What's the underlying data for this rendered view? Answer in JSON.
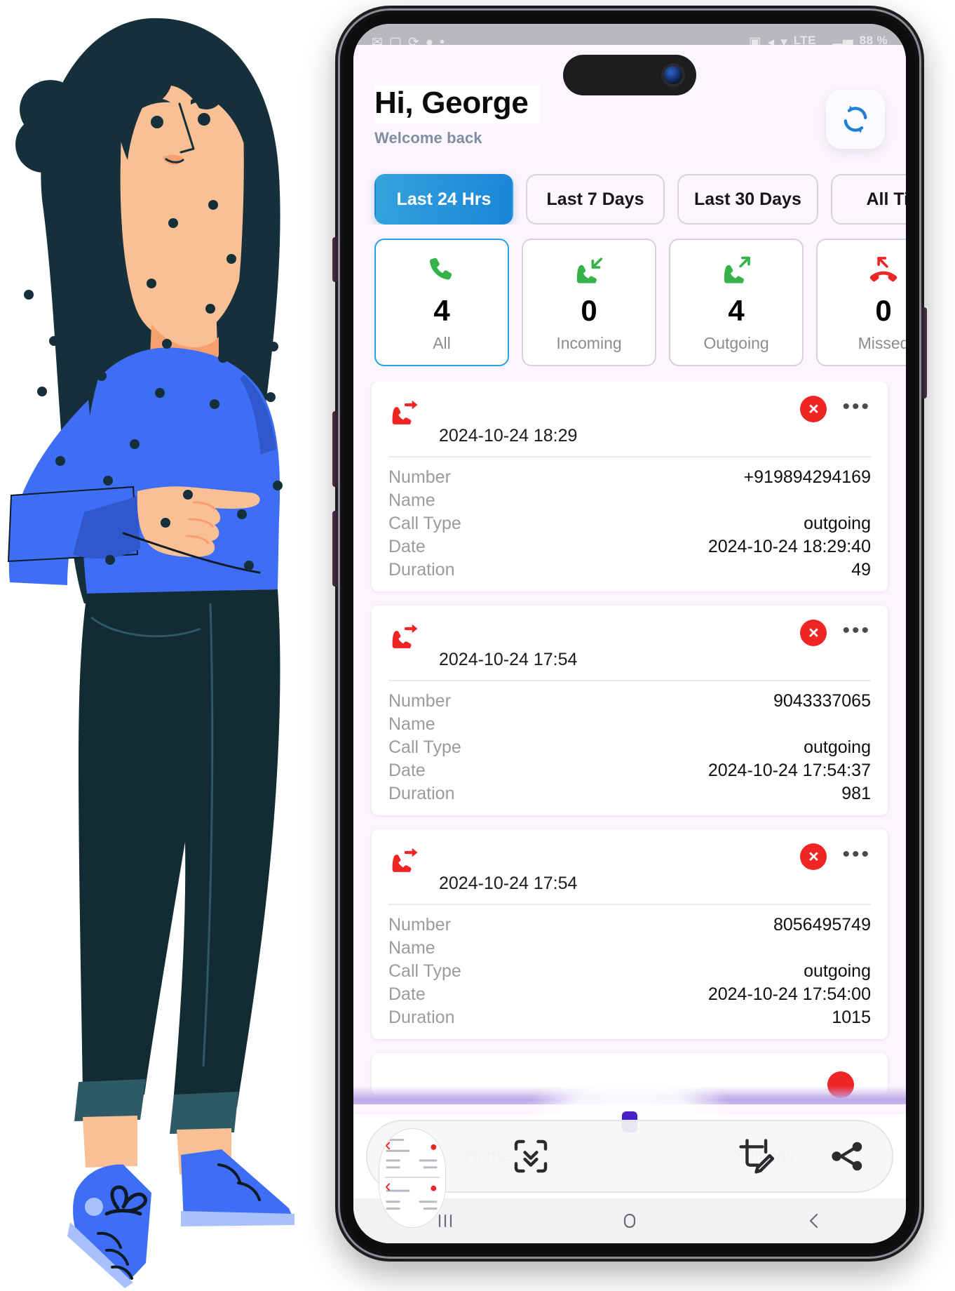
{
  "status_bar": {
    "left_icons": [
      "message-icon",
      "image-icon",
      "sync-icon",
      "chat-icon",
      "dot-icon"
    ],
    "right_icons": [
      "screenshot-icon",
      "mute-icon",
      "wifi-off-icon"
    ],
    "network": "LTE",
    "signal": "signal-bars-icon",
    "battery": "88 %"
  },
  "header": {
    "greeting": "Hi, George",
    "subtitle": "Welcome back",
    "refresh_icon": "refresh-icon"
  },
  "filters": [
    {
      "label": "Last 24 Hrs",
      "active": true
    },
    {
      "label": "Last 7 Days",
      "active": false
    },
    {
      "label": "Last 30 Days",
      "active": false
    },
    {
      "label": "All Time",
      "active": false
    }
  ],
  "stats": [
    {
      "label": "All",
      "count": "4",
      "icon": "phone-icon",
      "color": "#35b34a",
      "active": true
    },
    {
      "label": "Incoming",
      "count": "0",
      "icon": "phone-incoming-icon",
      "color": "#35b34a",
      "active": false
    },
    {
      "label": "Outgoing",
      "count": "4",
      "icon": "phone-outgoing-icon",
      "color": "#35b34a",
      "active": false
    },
    {
      "label": "Missed",
      "count": "0",
      "icon": "phone-missed-icon",
      "color": "#ef2424",
      "active": false
    }
  ],
  "detail_labels": {
    "number": "Number",
    "name": "Name",
    "call_type": "Call Type",
    "date": "Date",
    "duration": "Duration"
  },
  "calls": [
    {
      "icon": "phone-outgoing-red-icon",
      "time": "2024-10-24 18:29",
      "number": "+919894294169",
      "name": "",
      "call_type": "outgoing",
      "date": "2024-10-24 18:29:40",
      "duration": "49",
      "delete_label": "×",
      "more_label": "•••"
    },
    {
      "icon": "phone-outgoing-red-icon",
      "time": "2024-10-24 17:54",
      "number": "9043337065",
      "name": "",
      "call_type": "outgoing",
      "date": "2024-10-24 17:54:37",
      "duration": "981",
      "delete_label": "×",
      "more_label": "•••"
    },
    {
      "icon": "phone-outgoing-red-icon",
      "time": "2024-10-24 17:54",
      "number": "8056495749",
      "name": "",
      "call_type": "outgoing",
      "date": "2024-10-24 17:54:00",
      "duration": "1015",
      "delete_label": "×",
      "more_label": "•••"
    }
  ],
  "bottom_nav": [
    {
      "label": "Home",
      "icon": "home-icon"
    },
    {
      "label": "Settings",
      "icon": "settings-icon"
    }
  ],
  "screenshot_toolbar": {
    "thumbnail": "screenshot-thumbnail",
    "scroll_capture_icon": "scroll-capture-icon",
    "crop_edit_icon": "crop-edit-icon",
    "share_icon": "share-icon",
    "handle": "drag-handle"
  },
  "android_nav": {
    "recents": "recents-icon",
    "home": "home-button-icon",
    "back": "back-icon"
  },
  "illustration": {
    "alt": "woman-pointing-illustration",
    "hair_color": "#16303b",
    "skin_color": "#f9bf95",
    "sweater_color": "#3d6ef5",
    "trouser_color": "#132b33",
    "shoe_color": "#3d6ef5"
  },
  "theme": {
    "accent_blue": "#1a84d6",
    "screen_bg": "#fdf5fd",
    "card_bg": "#ffffff",
    "danger_red": "#ef2424",
    "success_green": "#35b34a",
    "muted_text": "#9a9aa0"
  }
}
